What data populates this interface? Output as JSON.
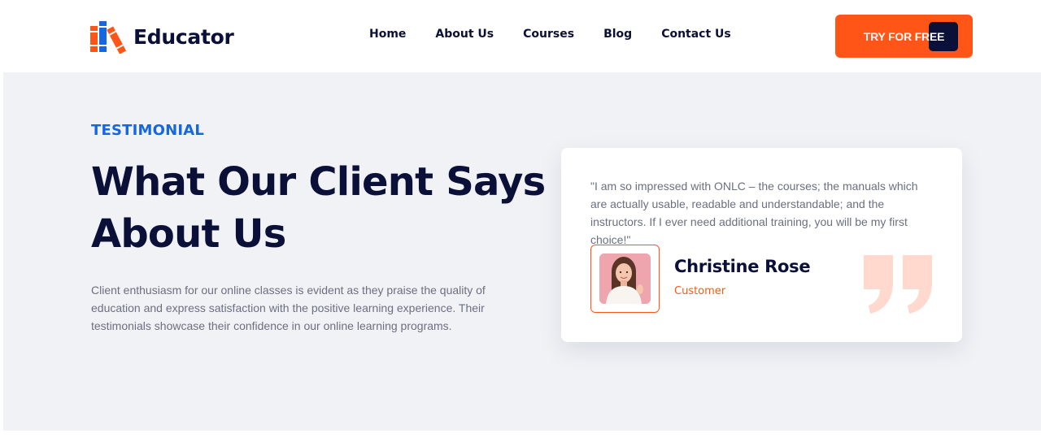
{
  "header": {
    "logo_text": "Educator",
    "nav": {
      "home": "Home",
      "about": "About Us",
      "courses": "Courses",
      "blog": "Blog",
      "contact": "Contact Us"
    },
    "cta_label": "TRY FOR FREE"
  },
  "testimonial": {
    "eyebrow": "TESTIMONIAL",
    "title_line1": "What Our Client Says",
    "title_line2": "About Us",
    "description": "Client enthusiasm for our online classes is evident as they praise the quality of education and express satisfaction with the positive learning experience. Their testimonials showcase their confidence in our online learning programs.",
    "card": {
      "quote": "\"I am so impressed with ONLC – the courses; the manuals which are actually usable, readable and understandable; and the instructors. If I ever need additional training, you will be my first choice!\"",
      "name": "Christine Rose",
      "role": "Customer"
    }
  },
  "colors": {
    "brand_orange": "#ff5618",
    "navy": "#0b1039",
    "accent_blue": "#1566e0",
    "section_bg": "#f1f2f6",
    "quote_icon": "#ffd9ce"
  },
  "icons": {
    "logo": "books-logo-icon",
    "quote": "quote-mark-icon"
  }
}
